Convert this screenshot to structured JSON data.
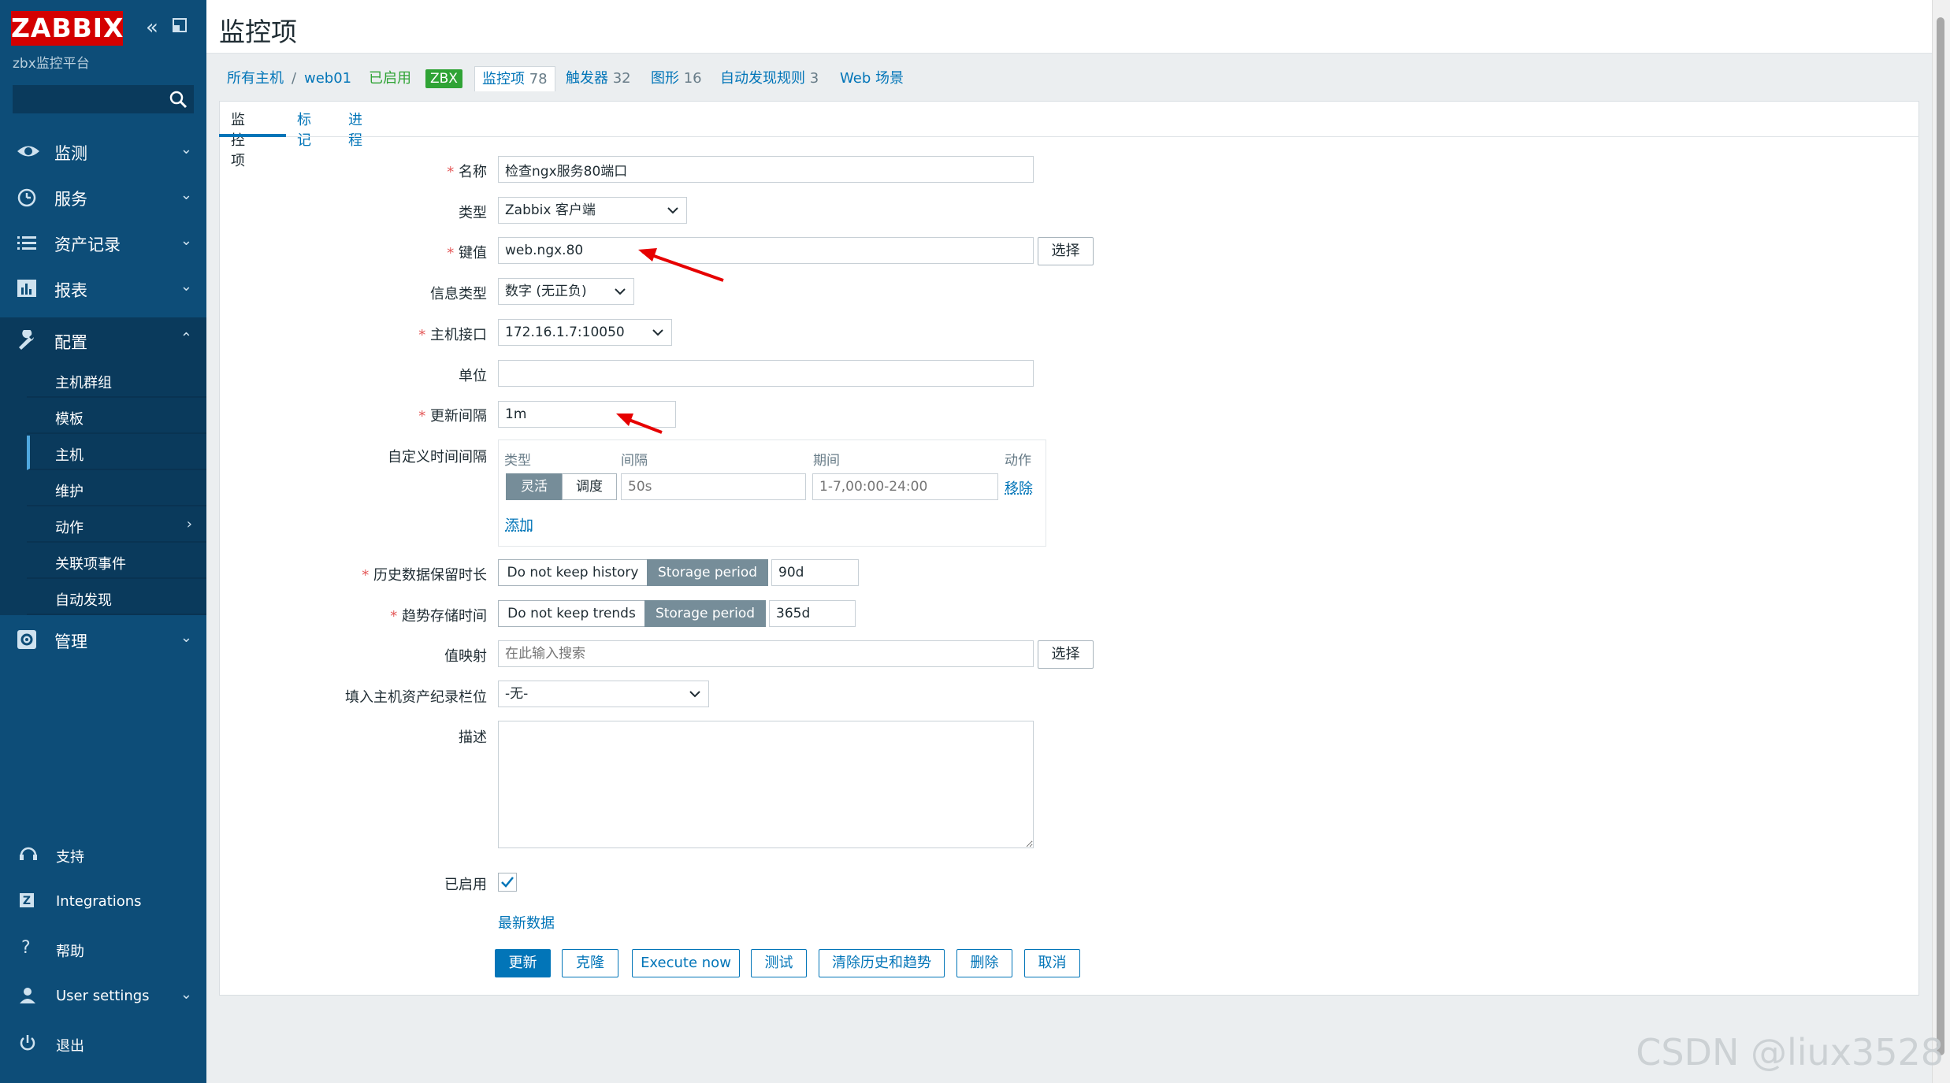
{
  "sidebar": {
    "logo_text": "ZABBIX",
    "subtitle": "zbx监控平台",
    "search_placeholder": "",
    "menu": [
      {
        "label": "监测",
        "icon": "eye-icon"
      },
      {
        "label": "服务",
        "icon": "clock-icon"
      },
      {
        "label": "资产记录",
        "icon": "list-icon"
      },
      {
        "label": "报表",
        "icon": "bar-chart-icon"
      },
      {
        "label": "配置",
        "icon": "wrench-icon"
      },
      {
        "label": "管理",
        "icon": "gear-icon"
      }
    ],
    "submenu": [
      {
        "label": "主机群组"
      },
      {
        "label": "模板"
      },
      {
        "label": "主机"
      },
      {
        "label": "维护"
      },
      {
        "label": "动作"
      },
      {
        "label": "关联项事件"
      },
      {
        "label": "自动发现"
      }
    ],
    "footer": [
      {
        "label": "支持",
        "icon": "headset-icon"
      },
      {
        "label": "Integrations",
        "icon": "zabbix-z-icon"
      },
      {
        "label": "帮助",
        "icon": "question-icon"
      },
      {
        "label": "User settings",
        "icon": "user-icon"
      },
      {
        "label": "退出",
        "icon": "power-icon"
      }
    ]
  },
  "page": {
    "title": "监控项"
  },
  "breadcrumbs": {
    "all_hosts": "所有主机",
    "separator": "/",
    "host": "web01",
    "status": "已启用",
    "zbx": "ZBX",
    "items_label": "监控项",
    "items_count": "78",
    "triggers_label": "触发器",
    "triggers_count": "32",
    "graphs_label": "图形",
    "graphs_count": "16",
    "discovery_label": "自动发现规则",
    "discovery_count": "3",
    "web_label": "Web 场景"
  },
  "tabs": [
    "监控项",
    "标记",
    "进程"
  ],
  "form": {
    "name": {
      "label": "名称",
      "value": "检查ngx服务80端口"
    },
    "type": {
      "label": "类型",
      "value": "Zabbix 客户端"
    },
    "key": {
      "label": "键值",
      "value": "web.ngx.80",
      "select_label": "选择"
    },
    "info_type": {
      "label": "信息类型",
      "value": "数字 (无正负)"
    },
    "interface": {
      "label": "主机接口",
      "value": "172.16.1.7:10050"
    },
    "units": {
      "label": "单位",
      "value": ""
    },
    "update_interval": {
      "label": "更新间隔",
      "value": "1m"
    },
    "custom_intervals": {
      "label": "自定义时间间隔",
      "headers": [
        "类型",
        "间隔",
        "期间",
        "动作"
      ],
      "row": {
        "flexible": "灵活",
        "scheduling": "调度",
        "interval_placeholder": "50s",
        "period_placeholder": "1-7,00:00-24:00",
        "remove": "移除"
      },
      "add": "添加"
    },
    "history": {
      "label": "历史数据保留时长",
      "no_keep": "Do not keep history",
      "storage": "Storage period",
      "value": "90d"
    },
    "trends": {
      "label": "趋势存储时间",
      "no_keep": "Do not keep trends",
      "storage": "Storage period",
      "value": "365d"
    },
    "valuemap": {
      "label": "值映射",
      "placeholder": "在此输入搜索",
      "select_label": "选择"
    },
    "inventory": {
      "label": "填入主机资产纪录栏位",
      "value": "-无-"
    },
    "description": {
      "label": "描述",
      "value": ""
    },
    "enabled": {
      "label": "已启用",
      "checked": true
    },
    "latest_data": "最新数据"
  },
  "buttons": {
    "update": "更新",
    "clone": "克隆",
    "execute_now": "Execute now",
    "test": "测试",
    "clear": "清除历史和趋势",
    "delete": "删除",
    "cancel": "取消"
  },
  "watermark": "CSDN @liux3528",
  "colors": {
    "sidebar": "#0d4d78",
    "accent": "#0275b8",
    "logo": "#d40000",
    "enabled": "#2fa335",
    "required": "#e45959",
    "segment_on": "#768d99"
  }
}
